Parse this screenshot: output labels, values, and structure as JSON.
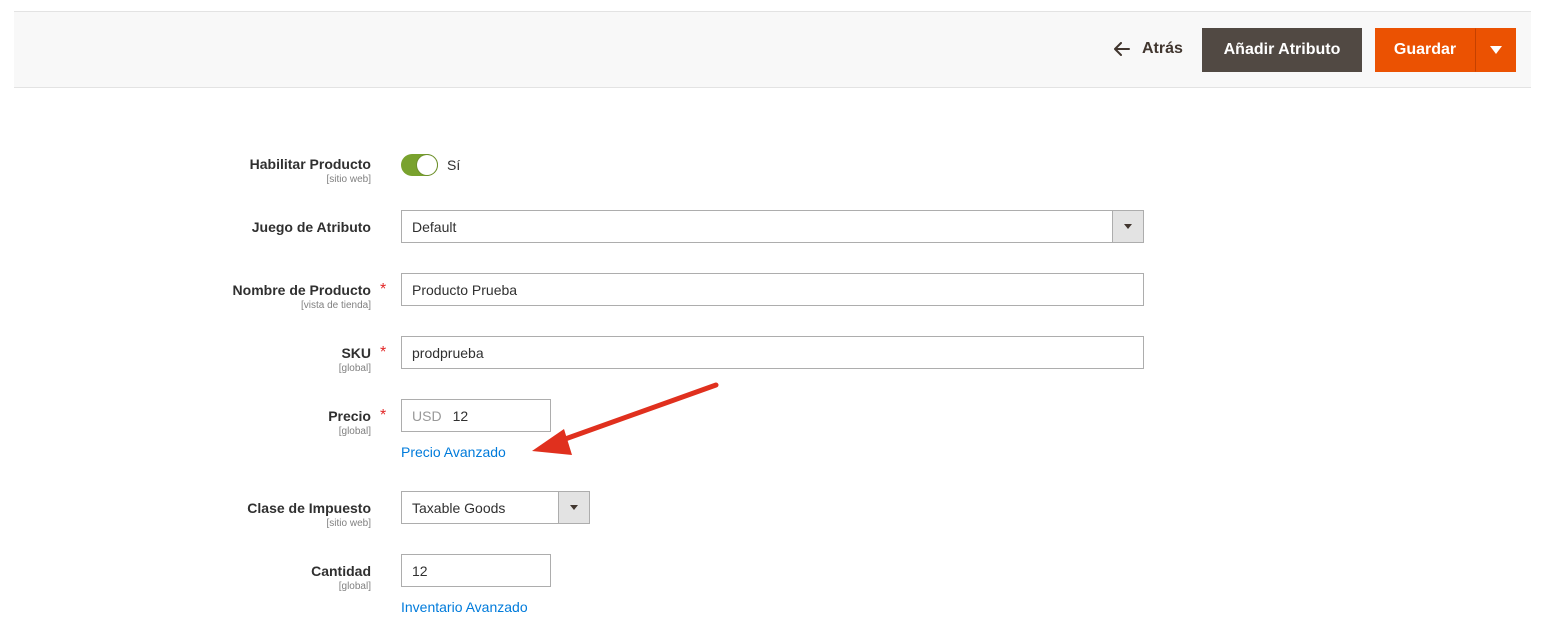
{
  "actions": {
    "back_label": "Atrás",
    "add_attribute_label": "Añadir Atributo",
    "save_label": "Guardar"
  },
  "fields": {
    "enable": {
      "label": "Habilitar Producto",
      "scope": "[sitio web]",
      "value": "Sí"
    },
    "attribute_set": {
      "label": "Juego de Atributo",
      "value": "Default"
    },
    "name": {
      "label": "Nombre de Producto",
      "scope": "[vista de tienda]",
      "value": "Producto Prueba",
      "required": "*"
    },
    "sku": {
      "label": "SKU",
      "scope": "[global]",
      "value": "prodprueba",
      "required": "*"
    },
    "price": {
      "label": "Precio",
      "scope": "[global]",
      "currency": "USD",
      "value": "12",
      "required": "*",
      "link": "Precio Avanzado"
    },
    "tax_class": {
      "label": "Clase de Impuesto",
      "scope": "[sitio web]",
      "value": "Taxable Goods"
    },
    "quantity": {
      "label": "Cantidad",
      "scope": "[global]",
      "value": "12",
      "link": "Inventario Avanzado"
    }
  },
  "colors": {
    "primary": "#eb5202",
    "secondary": "#514943",
    "toggle_on": "#79a22e",
    "link": "#007bdb",
    "required": "#e22626",
    "annotation_arrow": "#e0301e"
  },
  "icons": {
    "back": "arrow-left-icon",
    "dropdown": "triangle-down-icon",
    "annotation": "red-arrow-annotation"
  }
}
